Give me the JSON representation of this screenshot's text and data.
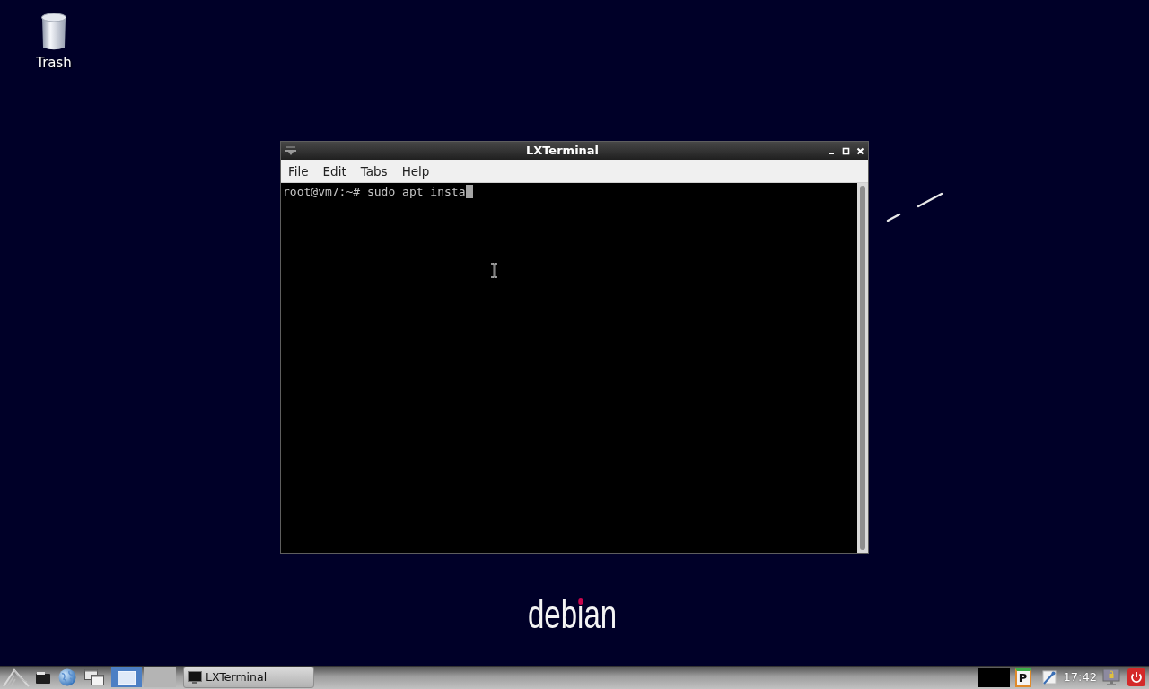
{
  "desktop": {
    "icons": [
      {
        "kind": "trash",
        "label": "Trash"
      }
    ],
    "logo": {
      "text": "debian"
    }
  },
  "window": {
    "title": "LXTerminal",
    "menu": [
      {
        "label": "File"
      },
      {
        "label": "Edit"
      },
      {
        "label": "Tabs"
      },
      {
        "label": "Help"
      }
    ],
    "terminal": {
      "lines": [
        {
          "text": "root@vm7:~# sudo apt insta",
          "cursor": true
        }
      ]
    }
  },
  "taskbar": {
    "workspaces": [
      {
        "selected": true,
        "has_window": true
      },
      {
        "selected": false,
        "has_window": false
      }
    ],
    "tasks": [
      {
        "label": "LXTerminal",
        "selected": false
      }
    ],
    "clipboard_badge": "P",
    "clock": "17:42"
  }
}
